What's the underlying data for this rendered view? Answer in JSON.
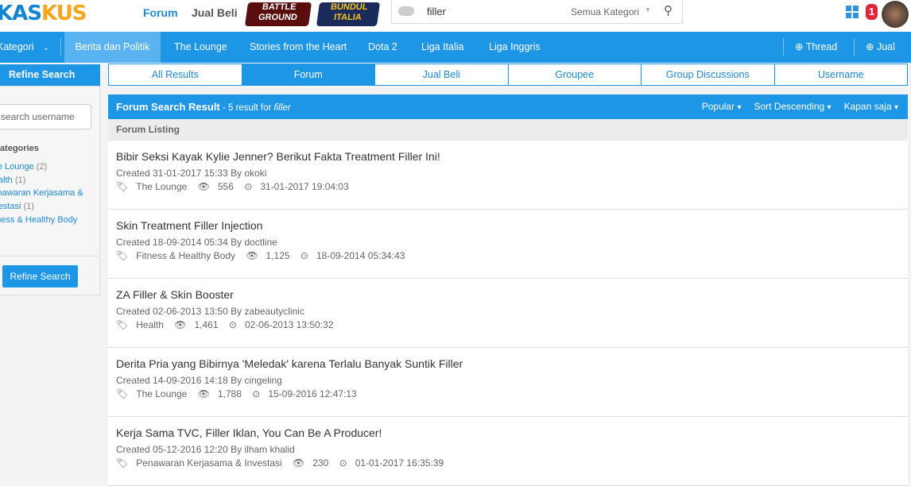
{
  "header": {
    "logo": "KASKUS",
    "links": [
      "Forum",
      "Jual Beli"
    ],
    "badges": [
      "BATTLE GROUND",
      "BUNDUL ITALIA"
    ],
    "search_value": "filler",
    "search_category": "Semua Kategori",
    "notification_count": "1"
  },
  "nav": {
    "category": "Kategori",
    "items": [
      "Berita dan Politik",
      "The Lounge",
      "Stories from the Heart",
      "Dota 2",
      "Liga Italia",
      "Liga Inggris"
    ],
    "thread": "Thread",
    "jual": "Jual"
  },
  "tabs": [
    "All Results",
    "Forum",
    "Jual Beli",
    "Groupee",
    "Group Discussions",
    "Username"
  ],
  "sidebar": {
    "title": "Refine Search",
    "username_placeholder": "search username",
    "categories_title": "Categories",
    "categories": [
      {
        "name": "The Lounge",
        "count": "(2)"
      },
      {
        "name": "Health",
        "count": "(1)"
      },
      {
        "name": "Penawaran Kerjasama & Investasi",
        "count": "(1)"
      },
      {
        "name": "Fitness & Healthy Body",
        "count": ""
      }
    ],
    "button": "Refine Search"
  },
  "results": {
    "title": "Forum Search Result",
    "summary": " - 5 result for ",
    "query": "filler",
    "sort": [
      "Popular",
      "Sort Descending",
      "Kapan saja"
    ],
    "listing_label": "Forum Listing",
    "items": [
      {
        "title": "Bibir Seksi Kayak Kylie Jenner? Berikut Fakta Treatment Filler Ini!",
        "created": "Created 31-01-2017 15:33 By ",
        "author": "okoki",
        "category": "The Lounge",
        "views": "556",
        "last": "31-01-2017 19:04:03"
      },
      {
        "title": "Skin Treatment Filler Injection",
        "created": "Created 18-09-2014 05:34 By ",
        "author": "doctline",
        "category": "Fitness & Healthy Body",
        "views": "1,125",
        "last": "18-09-2014 05:34:43"
      },
      {
        "title": "ZA Filler & Skin Booster",
        "created": "Created 02-06-2013 13:50 By ",
        "author": "zabeautyclinic",
        "category": "Health",
        "views": "1,461",
        "last": "02-06-2013 13:50:32"
      },
      {
        "title": "Derita Pria yang Bibirnya 'Meledak' karena Terlalu Banyak Suntik Filler",
        "created": "Created 14-09-2016 14:18 By ",
        "author": "cingeling",
        "category": "The Lounge",
        "views": "1,788",
        "last": "15-09-2016 12:47:13"
      },
      {
        "title": "Kerja Sama TVC, Filler Iklan, You Can Be A Producer!",
        "created": "Created 05-12-2016 12:20 By ",
        "author": "ilham khalid",
        "category": "Penawaran Kerjasama & Investasi",
        "views": "230",
        "last": "01-01-2017 16:35:39"
      }
    ]
  }
}
